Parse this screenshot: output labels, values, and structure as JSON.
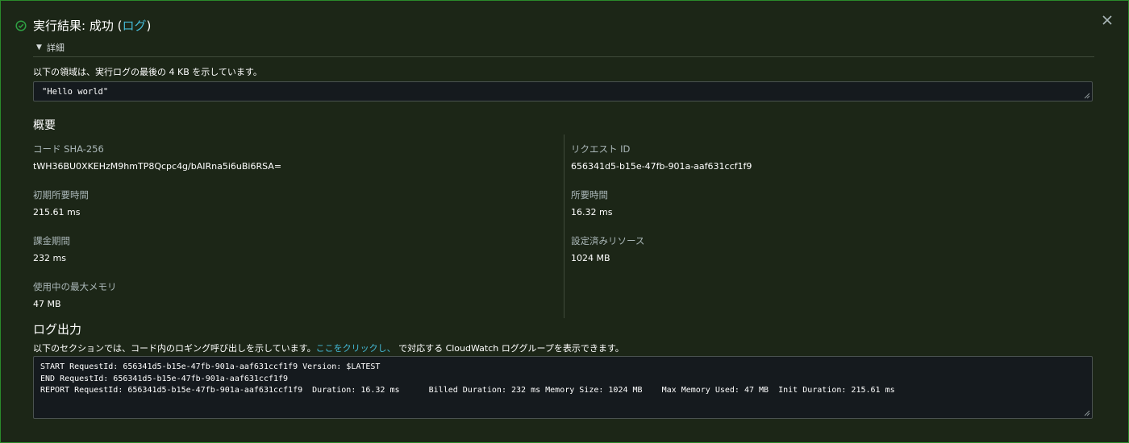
{
  "header": {
    "title_prefix": "実行結果: 成功 (",
    "title_link": "ログ",
    "title_suffix": ")"
  },
  "details": {
    "toggle_label": "詳細",
    "info_text": "以下の領域は、実行ログの最後の 4 KB を示しています。",
    "result_value": "\"Hello world\""
  },
  "summary": {
    "title": "概要",
    "left": [
      {
        "label": "コード SHA-256",
        "value": "tWH36BU0XKEHzM9hmTP8Qcpc4g/bAIRna5i6uBi6RSA="
      },
      {
        "label": "初期所要時間",
        "value": "215.61 ms"
      },
      {
        "label": "課金期間",
        "value": "232 ms"
      },
      {
        "label": "使用中の最大メモリ",
        "value": "47 MB"
      }
    ],
    "right": [
      {
        "label": "リクエスト ID",
        "value": "656341d5-b15e-47fb-901a-aaf631ccf1f9"
      },
      {
        "label": "所要時間",
        "value": "16.32 ms"
      },
      {
        "label": "設定済みリソース",
        "value": "1024 MB"
      }
    ]
  },
  "log": {
    "title": "ログ出力",
    "desc_prefix": "以下のセクションでは、コード内のロギング呼び出しを示しています。",
    "desc_link": "ここをクリックし、",
    "desc_suffix": " で対応する CloudWatch ロググループを表示できます。",
    "lines": [
      "START RequestId: 656341d5-b15e-47fb-901a-aaf631ccf1f9 Version: $LATEST",
      "END RequestId: 656341d5-b15e-47fb-901a-aaf631ccf1f9",
      "REPORT RequestId: 656341d5-b15e-47fb-901a-aaf631ccf1f9  Duration: 16.32 ms      Billed Duration: 232 ms Memory Size: 1024 MB    Max Memory Used: 47 MB  Init Duration: 215.61 ms"
    ]
  },
  "colors": {
    "success": "#2ea043",
    "link": "#44b9d6",
    "background": "#1c2617",
    "border": "#2a8a2a"
  },
  "icons": {
    "status": "check-circle-icon",
    "close": "close-icon",
    "toggle": "caret-down-icon",
    "resize": "resize-grip-icon"
  }
}
